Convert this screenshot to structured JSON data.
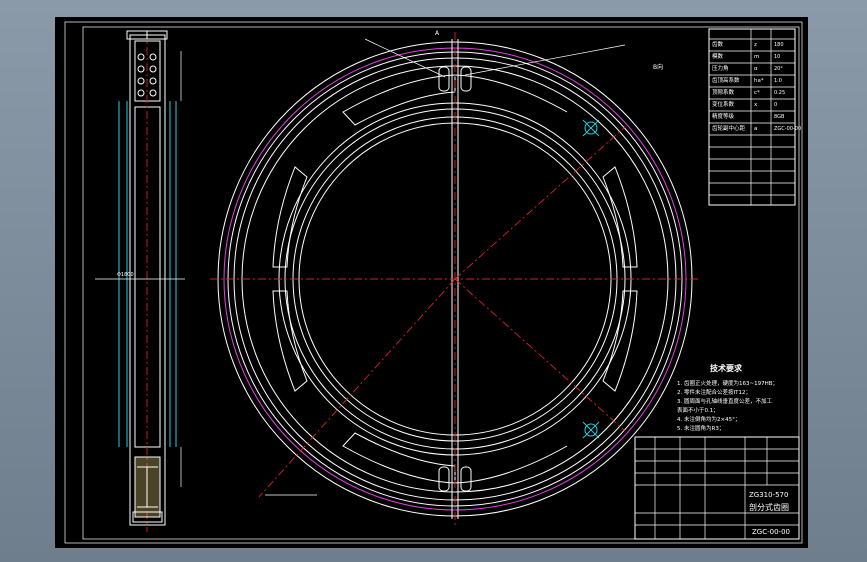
{
  "drawing": {
    "tech_requirements": {
      "title": "技术要求",
      "items": [
        "1. 齿圈正火处理，硬度为163~197HB；",
        "2. 零件未注配合公差按IT12；",
        "3. 圆周面与孔轴线垂直度公差，不加工",
        "   表面不小于0.1；",
        "4. 未注倒角均为2×45°；",
        "5. 未注圆角为R3；"
      ]
    },
    "title_block": {
      "part_name": "剖分式齿圈",
      "drawing_no": "ZGC-00-00",
      "material": "ZG310-570"
    },
    "params": [
      {
        "name": "齿数",
        "sym": "z",
        "val": "180"
      },
      {
        "name": "模数",
        "sym": "m",
        "val": "10"
      },
      {
        "name": "压力角",
        "sym": "α",
        "val": "20°"
      },
      {
        "name": "齿顶高系数",
        "sym": "ha*",
        "val": "1.0"
      },
      {
        "name": "顶隙系数",
        "sym": "c*",
        "val": "0.25"
      },
      {
        "name": "变位系数",
        "sym": "x",
        "val": "0"
      },
      {
        "name": "精度等级",
        "sym": "",
        "val": "8GB"
      },
      {
        "name": "齿轮副中心距",
        "sym": "a",
        "val": "ZGC-00-00"
      }
    ],
    "labels": {
      "side_dim": "Φ1800",
      "view_marker": "A",
      "detail_label": "B向"
    }
  }
}
